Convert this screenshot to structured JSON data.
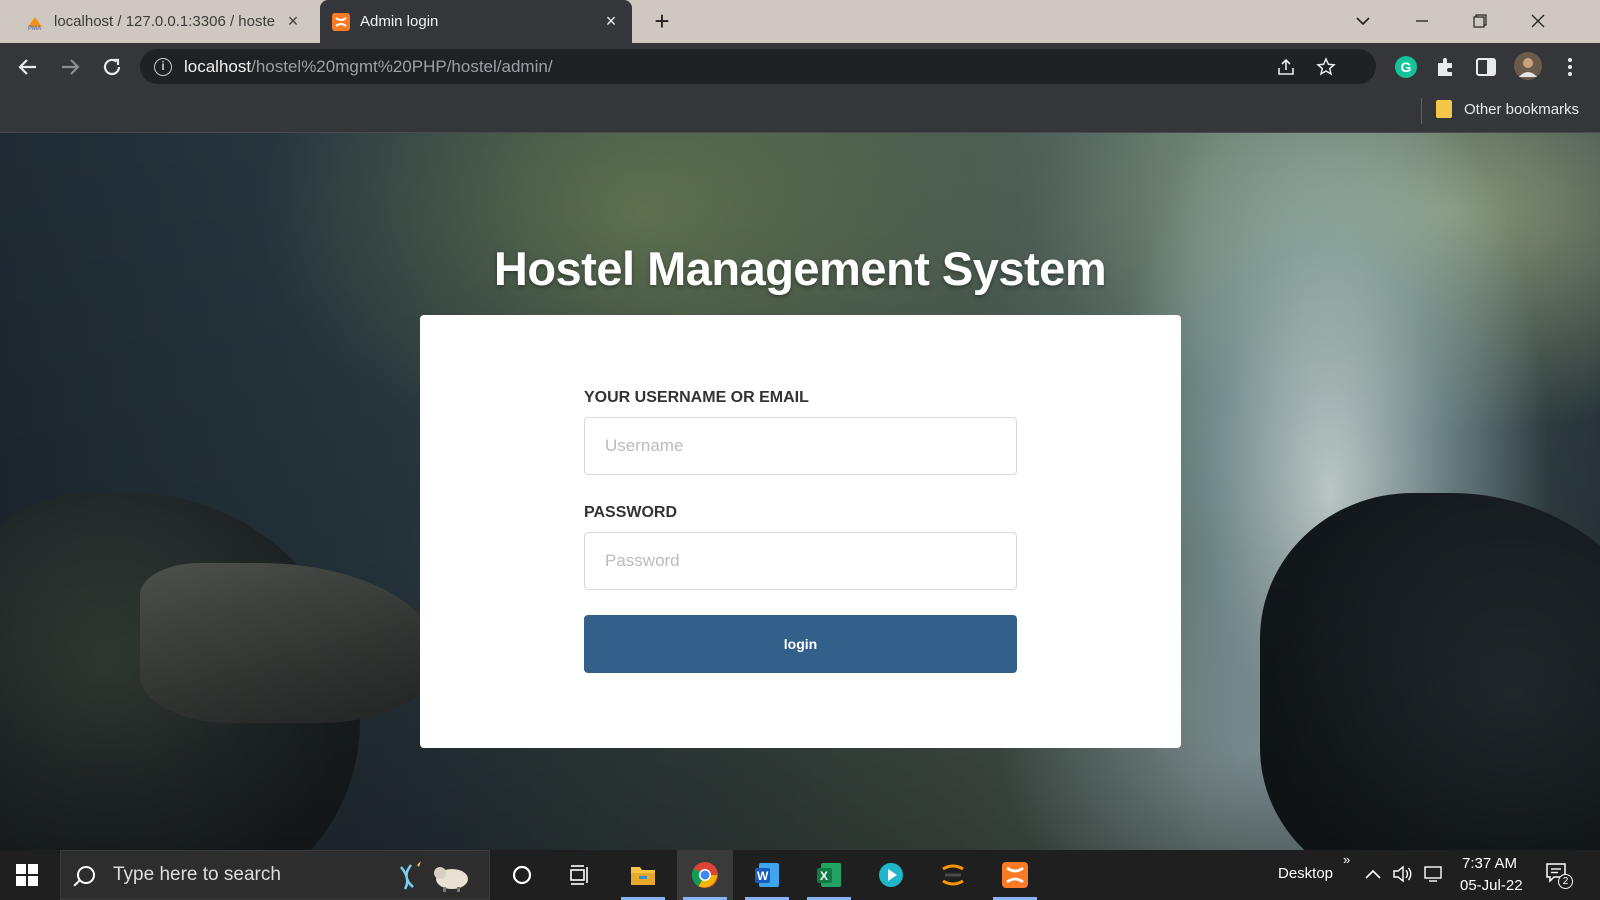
{
  "browser": {
    "tabs": [
      {
        "title": "localhost / 127.0.0.1:3306 / hoste",
        "favicon": "phpmyadmin-icon",
        "active": false
      },
      {
        "title": "Admin login",
        "favicon": "xampp-icon",
        "active": true
      }
    ],
    "url_host": "localhost",
    "url_path": "/hostel%20mgmt%20PHP/hostel/admin/",
    "bookmark_folder": "Other bookmarks"
  },
  "page": {
    "heading": "Hostel Management System",
    "username_label": "YOUR USERNAME OR EMAIL",
    "username_placeholder": "Username",
    "username_value": "",
    "password_label": "PASSWORD",
    "password_placeholder": "Password",
    "password_value": "",
    "login_label": "login",
    "accent_color": "#33608b"
  },
  "taskbar": {
    "search_placeholder": "Type here to search",
    "desktop_label": "Desktop",
    "time": "7:37 AM",
    "date": "05-Jul-22",
    "notification_count": "2",
    "pinned_apps": [
      "cortana-icon",
      "task-view-icon",
      "file-explorer-icon",
      "chrome-icon",
      "word-icon",
      "excel-icon",
      "media-player-icon",
      "sublime-icon",
      "xampp-icon"
    ]
  }
}
